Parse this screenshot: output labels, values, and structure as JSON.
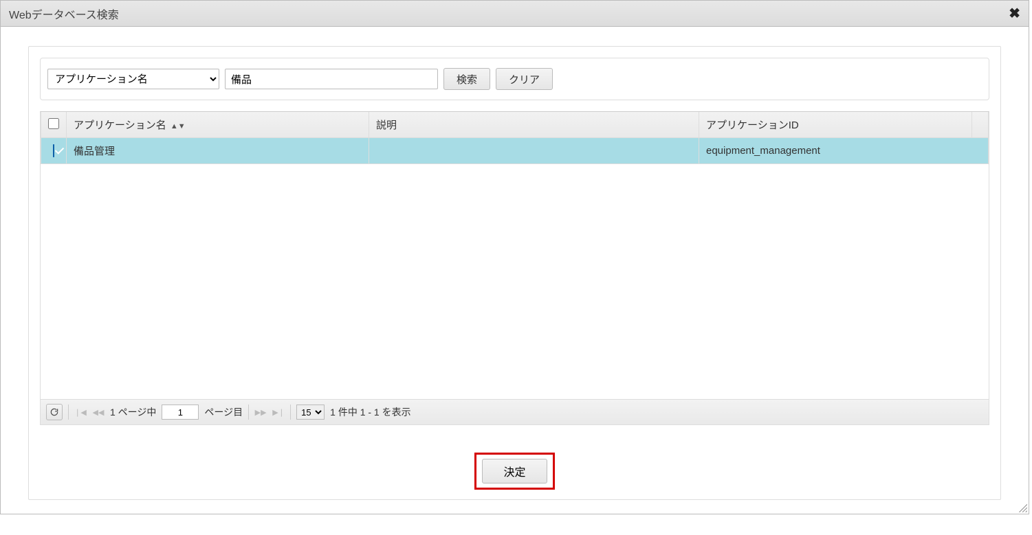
{
  "dialog": {
    "title": "Webデータベース検索"
  },
  "search": {
    "field_select": "アプリケーション名",
    "input_value": "備品",
    "search_btn": "検索",
    "clear_btn": "クリア"
  },
  "table": {
    "headers": {
      "app_name": "アプリケーション名",
      "description": "説明",
      "app_id": "アプリケーションID"
    },
    "rows": [
      {
        "checked": true,
        "app_name": "備品管理",
        "description": "",
        "app_id": "equipment_management"
      }
    ]
  },
  "pager": {
    "prefix": "1 ページ中",
    "page_value": "1",
    "suffix": "ページ目",
    "page_size": "15",
    "record_text": "1 件中 1 - 1 を表示"
  },
  "footer": {
    "confirm": "決定"
  }
}
